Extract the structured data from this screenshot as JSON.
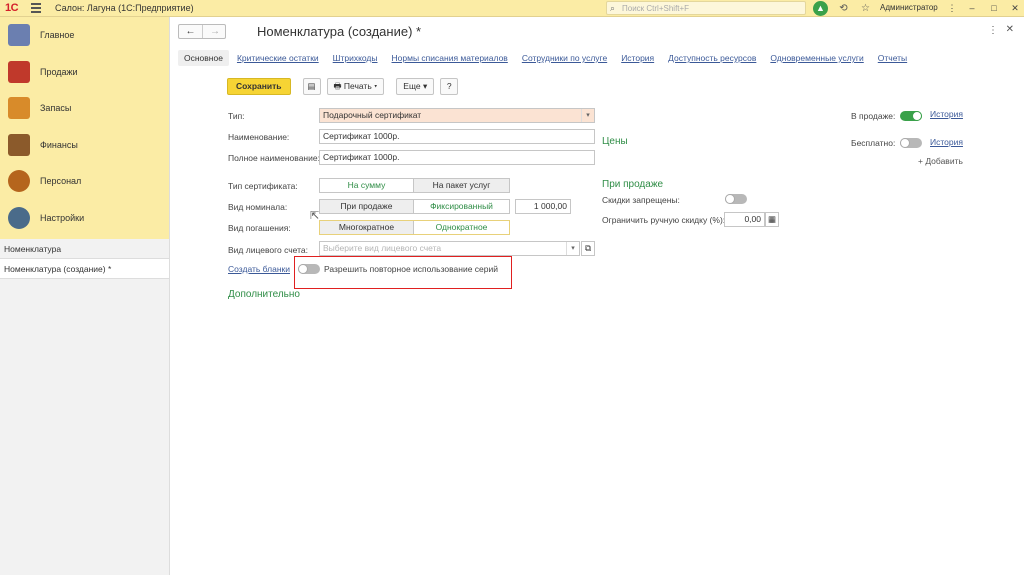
{
  "titlebar": {
    "logo": "1С",
    "app_title": "Салон: Лагуна (1С:Предприятие)",
    "search_placeholder": "Поиск Ctrl+Shift+F",
    "user": "Администратор"
  },
  "sidebar": {
    "sections": [
      {
        "label": "Главное",
        "icon": "clipboard-icon",
        "color": "#6b7fb0"
      },
      {
        "label": "Продажи",
        "icon": "chart-icon",
        "color": "#c0392b"
      },
      {
        "label": "Запасы",
        "icon": "boxes-icon",
        "color": "#d88b2a"
      },
      {
        "label": "Финансы",
        "icon": "wallet-icon",
        "color": "#8b5a2b"
      },
      {
        "label": "Персонал",
        "icon": "people-icon",
        "color": "#b5651d"
      },
      {
        "label": "Настройки",
        "icon": "gear-icon",
        "color": "#4a6b8a"
      }
    ],
    "open_windows": [
      {
        "label": "Номенклатура",
        "active": false
      },
      {
        "label": "Номенклатура (создание) *",
        "active": true
      }
    ]
  },
  "form": {
    "title": "Номенклатура (создание) *",
    "tabs": [
      "Основное",
      "Критические остатки",
      "Штрихкоды",
      "Нормы списания материалов",
      "Сотрудники по услуге",
      "История",
      "Доступность ресурсов",
      "Одновременные услуги",
      "Отчеты"
    ],
    "toolbar": {
      "save": "Сохранить",
      "print": "Печать",
      "more": "Еще",
      "help": "?"
    },
    "fields": {
      "type_label": "Тип:",
      "type_value": "Подарочный сертификат",
      "name_label": "Наименование:",
      "name_value": "Сертификат 1000р.",
      "full_name_label": "Полное наименование:",
      "full_name_value": "Сертификат 1000р.",
      "cert_type_label": "Тип сертификата:",
      "cert_type_opt1": "На сумму",
      "cert_type_opt2": "На пакет услуг",
      "nominal_label": "Вид номинала:",
      "nominal_opt1": "При продаже",
      "nominal_opt2": "Фиксированный",
      "nominal_amount": "1 000,00",
      "redeem_label": "Вид погашения:",
      "redeem_opt1": "Многократное",
      "redeem_opt2": "Однократное",
      "account_label": "Вид лицевого счета:",
      "account_placeholder": "Выберите вид лицевого счета",
      "create_forms_link": "Создать бланки",
      "reuse_series_label": "Разрешить повторное использование серий",
      "additional": "Дополнительно"
    },
    "right": {
      "on_sale_label": "В продаже:",
      "on_sale_history": "История",
      "free_label": "Бесплатно:",
      "free_history": "История",
      "add_link": "+ Добавить",
      "prices_head": "Цены",
      "on_sale_head": "При продаже",
      "discounts_forbidden_label": "Скидки запрещены:",
      "limit_discount_label": "Ограничить ручную скидку (%):",
      "limit_discount_value": "0,00"
    }
  },
  "colors": {
    "accent_yellow": "#fbeca5",
    "save_button": "#f6d434",
    "link": "#3b5998",
    "green": "#2f8d46",
    "highlight_red": "#e02020"
  }
}
